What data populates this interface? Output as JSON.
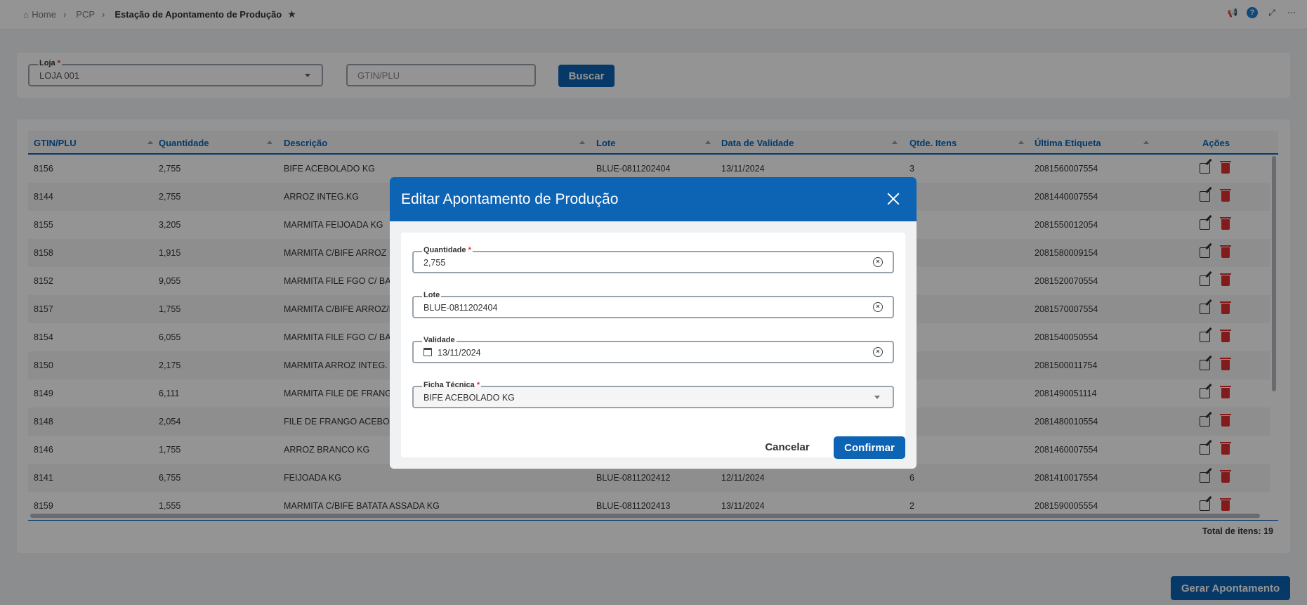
{
  "breadcrumb": {
    "home": "Home",
    "pcp": "PCP",
    "current": "Estação de Apontamento de Produção"
  },
  "filters": {
    "loja_label": "Loja",
    "loja_required": "*",
    "loja_value": "LOJA 001",
    "gtin_placeholder": "GTIN/PLU",
    "buscar_label": "Buscar"
  },
  "table": {
    "columns": [
      "GTIN/PLU",
      "Quantidade",
      "Descrição",
      "Lote",
      "Data de Validade",
      "Qtde. Itens",
      "Última Etiqueta",
      "Ações"
    ],
    "rows": [
      [
        "8156",
        "2,755",
        "BIFE ACEBOLADO KG",
        "BLUE-0811202404",
        "13/11/2024",
        "3",
        "2081560007554"
      ],
      [
        "8144",
        "2,755",
        "ARROZ INTEG.KG",
        "",
        "",
        "",
        "2081440007554"
      ],
      [
        "8155",
        "3,205",
        "MARMITA FEIJOADA KG",
        "",
        "",
        "",
        "2081550012054"
      ],
      [
        "8158",
        "1,915",
        "MARMITA C/BIFE ARROZ IN",
        "",
        "",
        "",
        "2081580009154"
      ],
      [
        "8152",
        "9,055",
        "MARMITA FILE FGO C/ BAT",
        "",
        "",
        "",
        "2081520070554"
      ],
      [
        "8157",
        "1,755",
        "MARMITA C/BIFE ARROZ/F",
        "",
        "",
        "",
        "2081570007554"
      ],
      [
        "8154",
        "6,055",
        "MARMITA FILE FGO C/ BAT",
        "",
        "",
        "",
        "2081540050554"
      ],
      [
        "8150",
        "2,175",
        "MARMITA ARROZ INTEG. F",
        "",
        "",
        "",
        "2081500011754"
      ],
      [
        "8149",
        "6,111",
        "MARMITA FILE DE FRANGO",
        "",
        "",
        "",
        "2081490051114"
      ],
      [
        "8148",
        "2,054",
        "FILE DE FRANGO ACEBOLA",
        "",
        "",
        "",
        "2081480010554"
      ],
      [
        "8146",
        "1,755",
        "ARROZ BRANCO KG",
        "",
        "",
        "",
        "2081460007554"
      ],
      [
        "8141",
        "6,755",
        "FEIJOADA KG",
        "BLUE-0811202412",
        "12/11/2024",
        "6",
        "2081410017554"
      ],
      [
        "8159",
        "1,555",
        "MARMITA C/BIFE BATATA ASSADA KG",
        "BLUE-0811202413",
        "13/11/2024",
        "2",
        "2081590005554"
      ]
    ],
    "total_label": "Total de itens: 19"
  },
  "gerar_label": "Gerar Apontamento",
  "modal": {
    "title": "Editar Apontamento de Produção",
    "quantidade_label": "Quantidade",
    "quantidade_value": "2,755",
    "lote_label": "Lote",
    "lote_value": "BLUE-0811202404",
    "validade_label": "Validade",
    "validade_value": "13/11/2024",
    "ficha_label": "Ficha Técnica",
    "ficha_value": "BIFE ACEBOLADO KG",
    "required_mark": "*",
    "cancel_label": "Cancelar",
    "confirm_label": "Confirmar"
  },
  "colors": {
    "primary": "#0d63b4",
    "danger": "#e03131"
  }
}
